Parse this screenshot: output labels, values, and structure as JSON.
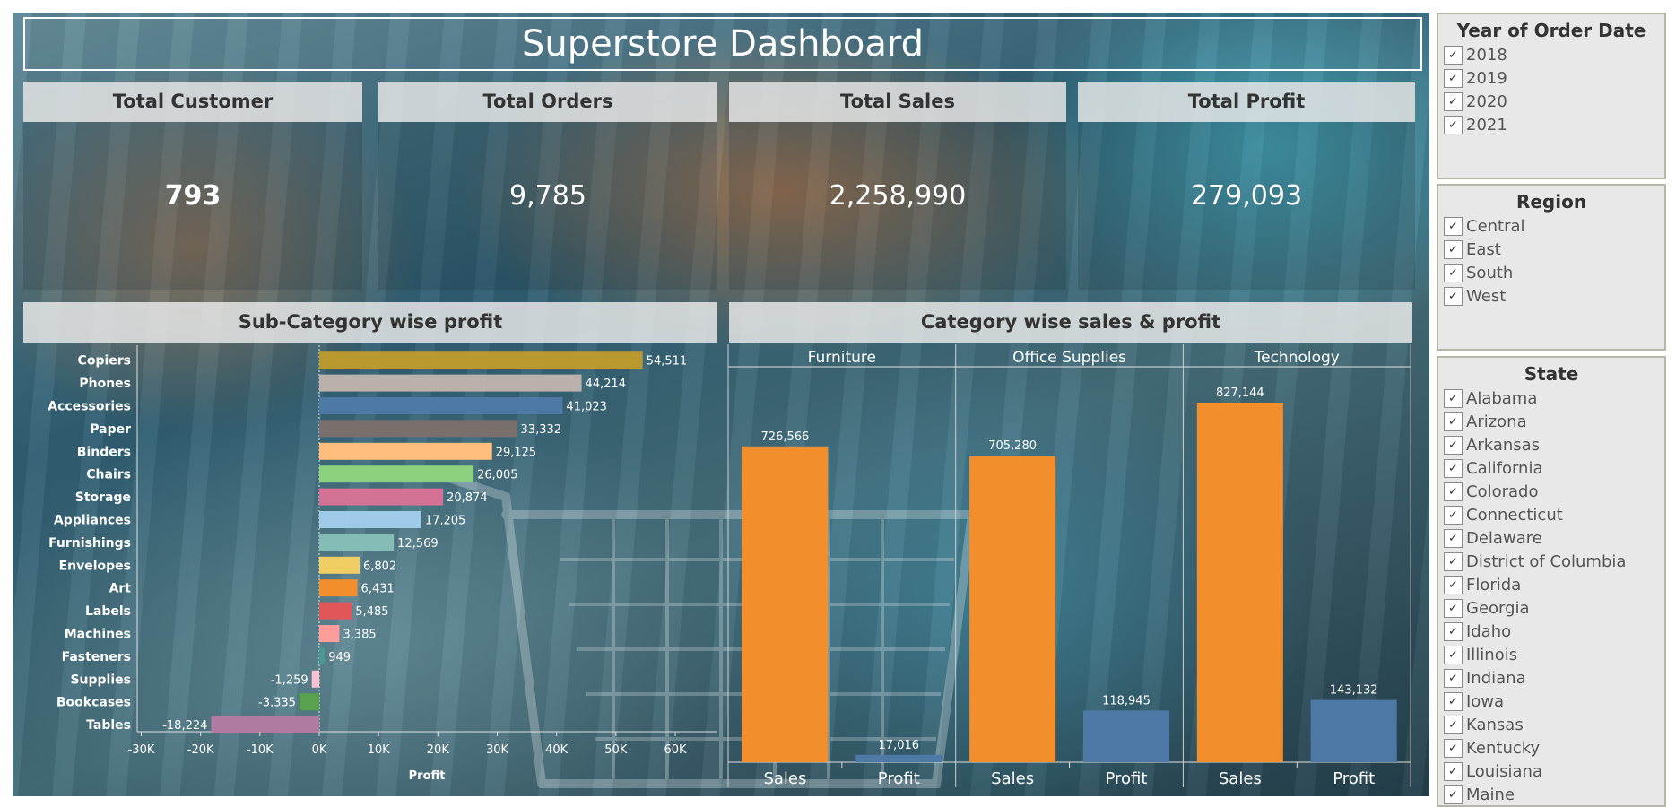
{
  "dashboard": {
    "title": "Superstore Dashboard",
    "kpis": [
      {
        "label": "Total Customer",
        "value": "793"
      },
      {
        "label": "Total Orders",
        "value": "9,785"
      },
      {
        "label": "Total Sales",
        "value": "2,258,990"
      },
      {
        "label": "Total Profit",
        "value": "279,093"
      }
    ]
  },
  "chart_data": [
    {
      "type": "bar",
      "orientation": "horizontal",
      "title": "Sub-Category wise profit",
      "xlabel": "Profit",
      "ylabel": "",
      "xlim": [
        -30000,
        60000
      ],
      "x_ticks": [
        "-30K",
        "-20K",
        "-10K",
        "0K",
        "10K",
        "20K",
        "30K",
        "40K",
        "50K",
        "60K"
      ],
      "categories": [
        "Copiers",
        "Phones",
        "Accessories",
        "Paper",
        "Binders",
        "Chairs",
        "Storage",
        "Appliances",
        "Furnishings",
        "Envelopes",
        "Art",
        "Labels",
        "Machines",
        "Fasteners",
        "Supplies",
        "Bookcases",
        "Tables"
      ],
      "values": [
        54511,
        44214,
        41023,
        33332,
        29125,
        26005,
        20874,
        17205,
        12569,
        6802,
        6431,
        5485,
        3385,
        949,
        -1259,
        -3335,
        -18224
      ],
      "value_labels": [
        "54,511",
        "44,214",
        "41,023",
        "33,332",
        "29,125",
        "26,005",
        "20,874",
        "17,205",
        "12,569",
        "6,802",
        "6,431",
        "5,485",
        "3,385",
        "949",
        "-1,259",
        "-3,335",
        "-18,224"
      ],
      "colors": [
        "#b9982e",
        "#bab0ac",
        "#4e79a7",
        "#79706e",
        "#ffbe7d",
        "#8cd17d",
        "#d37295",
        "#a0cbe8",
        "#86bcb6",
        "#f1ce63",
        "#f28e2b",
        "#e15759",
        "#ff9d9a",
        "#499894",
        "#fabfd2",
        "#59a14f",
        "#b07aa1"
      ],
      "grid": false
    },
    {
      "type": "bar",
      "title": "Category wise sales & profit",
      "panels": [
        "Furniture",
        "Office Supplies",
        "Technology"
      ],
      "categories": [
        "Sales",
        "Profit"
      ],
      "series": [
        {
          "panel": "Furniture",
          "values": [
            726566,
            17016
          ],
          "labels": [
            "726,566",
            "17,016"
          ]
        },
        {
          "panel": "Office Supplies",
          "values": [
            705280,
            118945
          ],
          "labels": [
            "705,280",
            "118,945"
          ]
        },
        {
          "panel": "Technology",
          "values": [
            827144,
            143132
          ],
          "labels": [
            "827,144",
            "143,132"
          ]
        }
      ],
      "colors": {
        "Sales": "#f28e2b",
        "Profit": "#4e79a7"
      },
      "ylim": [
        0,
        827144
      ],
      "grid": false
    }
  ],
  "filters": {
    "year": {
      "title": "Year of Order Date",
      "items": [
        "2018",
        "2019",
        "2020",
        "2021"
      ]
    },
    "region": {
      "title": "Region",
      "items": [
        "Central",
        "East",
        "South",
        "West"
      ]
    },
    "state": {
      "title": "State",
      "items": [
        "Alabama",
        "Arizona",
        "Arkansas",
        "California",
        "Colorado",
        "Connecticut",
        "Delaware",
        "District of Columbia",
        "Florida",
        "Georgia",
        "Idaho",
        "Illinois",
        "Indiana",
        "Iowa",
        "Kansas",
        "Kentucky",
        "Louisiana",
        "Maine"
      ]
    },
    "check_icon": "✓"
  }
}
